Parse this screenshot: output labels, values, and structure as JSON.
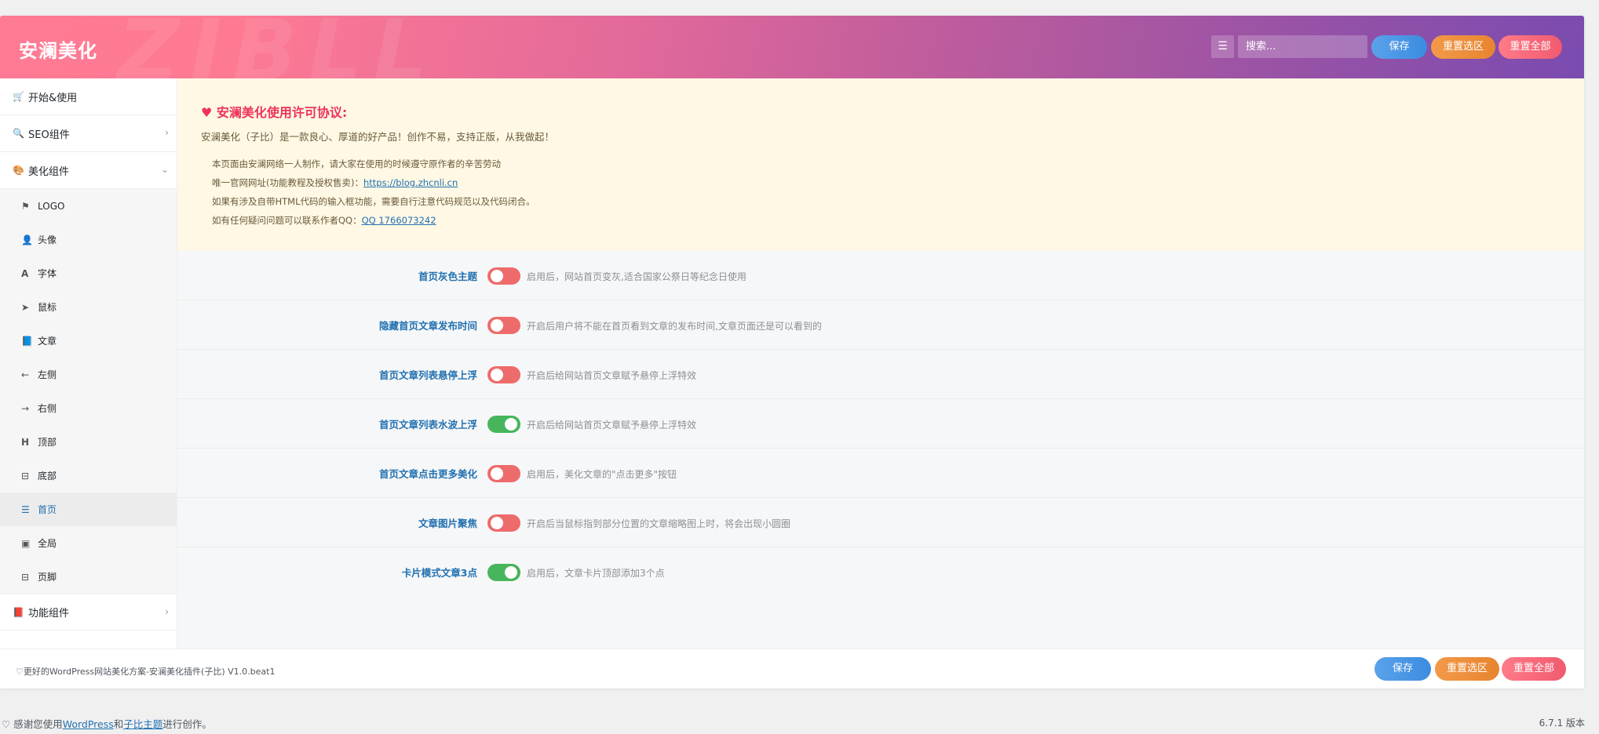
{
  "header": {
    "title": "安澜美化",
    "watermark": "ZIBLL",
    "search_placeholder": "搜索...",
    "save_label": "保存",
    "reset_section_label": "重置选区",
    "reset_all_label": "重置全部"
  },
  "sidebar": {
    "start": "开始&使用",
    "seo": "SEO组件",
    "beauty": "美化组件",
    "sub_items": [
      "LOGO",
      "头像",
      "字体",
      "鼠标",
      "文章",
      "左侧",
      "右侧",
      "顶部",
      "底部",
      "首页",
      "全局",
      "页脚"
    ],
    "function": "功能组件"
  },
  "notice": {
    "title": "安澜美化使用许可协议:",
    "intro": "安澜美化（子比）是一款良心、厚道的好产品！创作不易，支持正版，从我做起！",
    "line1": "本页面由安澜网络一人制作，请大家在使用的时候遵守原作者的辛苦劳动",
    "line2_prefix": "唯一官网网址(功能教程及授权售卖)：",
    "line2_link": "https://blog.zhcnli.cn",
    "line3": "如果有涉及自带HTML代码的输入框功能，需要自行注意代码规范以及代码闭合。",
    "line4_prefix": "如有任何疑问问题可以联系作者QQ：",
    "line4_link": "QQ 1766073242"
  },
  "settings": [
    {
      "label": "首页灰色主题",
      "enabled": false,
      "desc": "启用后，网站首页变灰,适合国家公祭日等纪念日使用"
    },
    {
      "label": "隐藏首页文章发布时间",
      "enabled": false,
      "desc": "开启后用户将不能在首页看到文章的发布时间,文章页面还是可以看到的"
    },
    {
      "label": "首页文章列表悬停上浮",
      "enabled": false,
      "desc": "开启后给网站首页文章赋予悬停上浮特效"
    },
    {
      "label": "首页文章列表水波上浮",
      "enabled": true,
      "desc": "开启后给网站首页文章赋予悬停上浮特效"
    },
    {
      "label": "首页文章点击更多美化",
      "enabled": false,
      "desc": "启用后，美化文章的\"点击更多\"按钮"
    },
    {
      "label": "文章图片聚焦",
      "enabled": false,
      "desc": "开启后当鼠标指到部分位置的文章缩略图上时，将会出现小圆圈"
    },
    {
      "label": "卡片模式文章3点",
      "enabled": true,
      "desc": "启用后，文章卡片顶部添加3个点"
    }
  ],
  "footer": {
    "text": "♡更好的WordPress网站美化方案-安澜美化插件(子比) V1.0.beat1",
    "save_label": "保存",
    "reset_section_label": "重置选区",
    "reset_all_label": "重置全部"
  },
  "wp_footer": {
    "prefix": "♡ 感谢您使用",
    "link1": "WordPress",
    "mid": "和",
    "link2": "子比主题",
    "suffix": "进行创作。",
    "version": "6.7.1 版本"
  },
  "colors": {
    "header_gradient_start": "#ff7b95",
    "header_gradient_end": "#7a4bb0",
    "toggle_on": "#47b55b",
    "toggle_off": "#ee6b6b",
    "label": "#2271b1",
    "notice_title": "#ee3357"
  }
}
